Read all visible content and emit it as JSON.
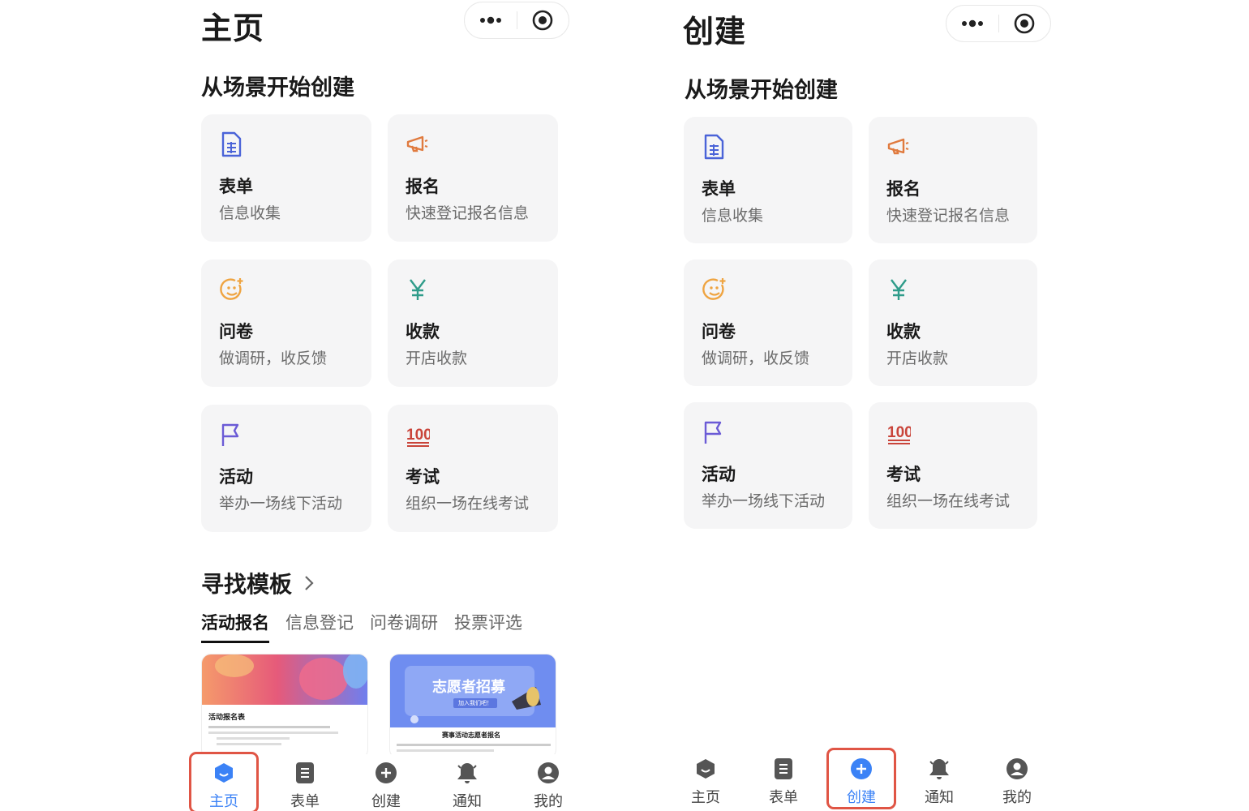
{
  "left": {
    "page_title": "主页",
    "section_title": "从场景开始创建",
    "cards": [
      {
        "title": "表单",
        "subtitle": "信息收集",
        "icon": "form-doc-icon"
      },
      {
        "title": "报名",
        "subtitle": "快速登记报名信息",
        "icon": "megaphone-icon"
      },
      {
        "title": "问卷",
        "subtitle": "做调研，收反馈",
        "icon": "smile-face-icon"
      },
      {
        "title": "收款",
        "subtitle": "开店收款",
        "icon": "yen-icon"
      },
      {
        "title": "活动",
        "subtitle": "举办一场线下活动",
        "icon": "flag-icon"
      },
      {
        "title": "考试",
        "subtitle": "组织一场在线考试",
        "icon": "score-100-icon"
      }
    ],
    "template_title": "寻找模板",
    "template_tabs": [
      "活动报名",
      "信息登记",
      "问卷调研",
      "投票评选"
    ],
    "thumbs": [
      {
        "title": "活动报名表"
      },
      {
        "banner": "志愿者招募",
        "banner_sub": "加入我们吧！",
        "title": "赛事活动志愿者报名"
      }
    ]
  },
  "right": {
    "page_title": "创建",
    "section_title": "从场景开始创建",
    "cards": [
      {
        "title": "表单",
        "subtitle": "信息收集",
        "icon": "form-doc-icon"
      },
      {
        "title": "报名",
        "subtitle": "快速登记报名信息",
        "icon": "megaphone-icon"
      },
      {
        "title": "问卷",
        "subtitle": "做调研，收反馈",
        "icon": "smile-face-icon"
      },
      {
        "title": "收款",
        "subtitle": "开店收款",
        "icon": "yen-icon"
      },
      {
        "title": "活动",
        "subtitle": "举办一场线下活动",
        "icon": "flag-icon"
      },
      {
        "title": "考试",
        "subtitle": "组织一场在线考试",
        "icon": "score-100-icon"
      }
    ]
  },
  "tabbar": [
    "主页",
    "表单",
    "创建",
    "通知",
    "我的"
  ],
  "icon_100": "100",
  "colors": {
    "accent_blue": "#3b82f6",
    "form_icon": "#4a63d8",
    "megaphone_icon": "#e07a3e",
    "smile_icon": "#efa441",
    "yen_icon": "#2f9c8a",
    "flag_icon": "#6b5bd6",
    "score_icon": "#c9443a",
    "highlight_red": "#e05545"
  }
}
